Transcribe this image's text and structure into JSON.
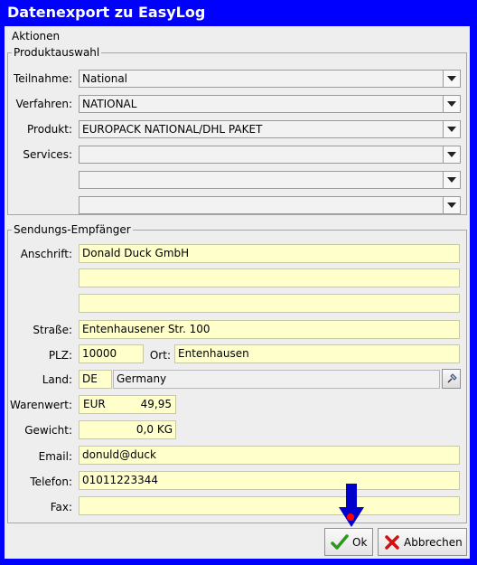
{
  "window": {
    "title": "Datenexport zu EasyLog"
  },
  "menu": {
    "aktionen": "Aktionen"
  },
  "produktauswahl": {
    "legend": "Produktauswahl",
    "teilnahme_label": "Teilnahme:",
    "teilnahme_value": "National",
    "verfahren_label": "Verfahren:",
    "verfahren_value": "NATIONAL",
    "produkt_label": "Produkt:",
    "produkt_value": "EUROPACK NATIONAL/DHL PAKET",
    "services_label": "Services:",
    "services": [
      "",
      "",
      ""
    ]
  },
  "empfaenger": {
    "legend": "Sendungs-Empfänger",
    "anschrift_label": "Anschrift:",
    "anschrift": [
      "Donald Duck GmbH",
      "",
      ""
    ],
    "strasse_label": "Straße:",
    "strasse_value": "Entenhausener Str. 100",
    "plz_label": "PLZ:",
    "plz_value": "10000",
    "ort_label": "Ort:",
    "ort_value": "Entenhausen",
    "land_label": "Land:",
    "land_code": "DE",
    "land_name": "Germany",
    "warenwert_label": "Warenwert:",
    "warenwert_currency": "EUR",
    "warenwert_amount": "49,95",
    "gewicht_label": "Gewicht:",
    "gewicht_value": "0,0 KG",
    "email_label": "Email:",
    "email_value": "donuld@duck",
    "telefon_label": "Telefon:",
    "telefon_value": "01011223344",
    "fax_label": "Fax:",
    "fax_value": ""
  },
  "buttons": {
    "ok_label": "Ok",
    "cancel_label": "Abbrechen"
  },
  "colors": {
    "frame": "#0000ff",
    "input_bg": "#ffffcc",
    "pointer": "#0000cc",
    "click_dot": "#ff0000"
  },
  "icons": {
    "ok": "checkmark-icon",
    "cancel": "red-x-icon",
    "lookup": "pin-icon",
    "pointer": "down-arrow-pointer-icon"
  }
}
